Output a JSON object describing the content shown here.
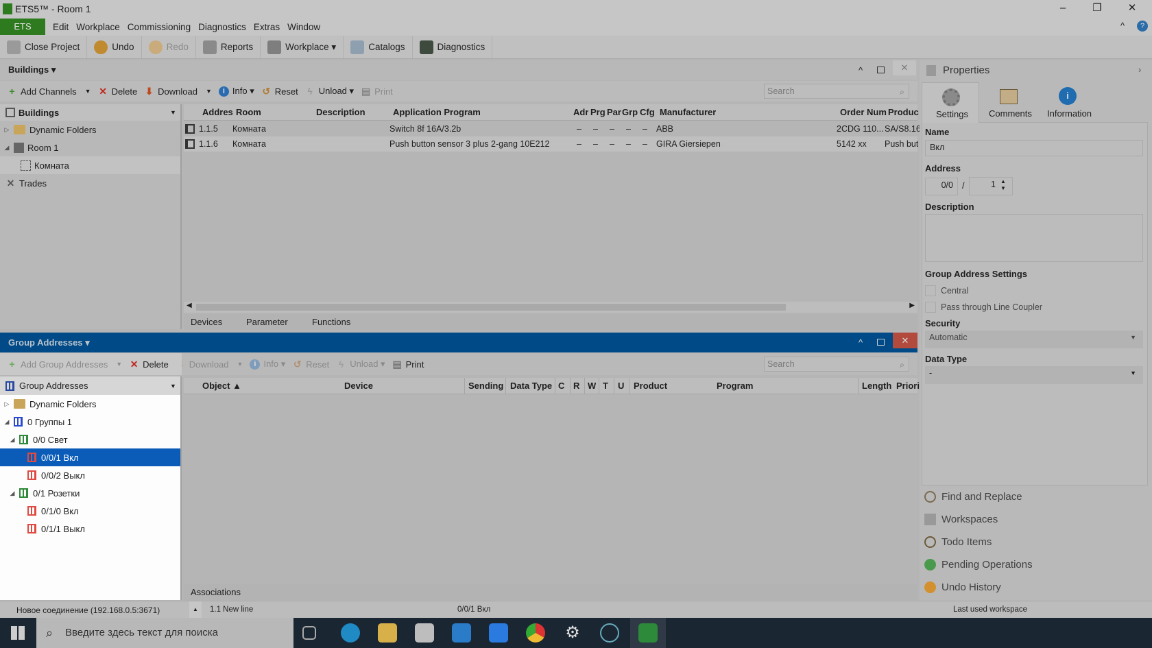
{
  "window": {
    "title": "ETS5™ - Room 1",
    "minimize": "–",
    "maximize": "❐",
    "close": "✕"
  },
  "menu": {
    "items": [
      "ETS",
      "Edit",
      "Workplace",
      "Commissioning",
      "Diagnostics",
      "Extras",
      "Window"
    ],
    "collapse": "^",
    "help": "?"
  },
  "toolbar": {
    "close_project": "Close Project",
    "undo": "Undo",
    "redo": "Redo",
    "reports": "Reports",
    "workplace": "Workplace ▾",
    "catalogs": "Catalogs",
    "diagnostics": "Diagnostics"
  },
  "buildings": {
    "title": "Buildings ▾",
    "toolbar": {
      "add_channels": "Add Channels",
      "delete": "Delete",
      "download": "Download",
      "info": "Info ▾",
      "reset": "Reset",
      "unload": "Unload ▾",
      "print": "Print"
    },
    "search_placeholder": "Search",
    "tree": {
      "header": "Buildings",
      "items": [
        "Dynamic Folders",
        "Room 1",
        "Комната",
        "Trades"
      ]
    },
    "columns": [
      "Addres",
      "Room",
      "Description",
      "Application Program",
      "Adr",
      "Prg",
      "Par",
      "Grp",
      "Cfg",
      "Manufacturer",
      "Order Num",
      "Produc"
    ],
    "rows": [
      [
        "1.1.5",
        "Комната",
        "",
        "Switch 8f 16A/3.2b",
        "–",
        "–",
        "–",
        "–",
        "–",
        "ABB",
        "2CDG 110...",
        "SA/S8.16"
      ],
      [
        "1.1.6",
        "Комната",
        "",
        "Push button sensor 3 plus 2-gang 10E212",
        "–",
        "–",
        "–",
        "–",
        "–",
        "GIRA Giersiepen",
        "5142 xx",
        "Push but"
      ]
    ],
    "tabs": [
      "Devices",
      "Parameter",
      "Functions"
    ]
  },
  "group_addresses": {
    "title": "Group Addresses ▾",
    "toolbar": {
      "add": "Add Group Addresses",
      "delete": "Delete",
      "download": "Download",
      "info": "Info ▾",
      "reset": "Reset",
      "unload": "Unload ▾",
      "print": "Print"
    },
    "search_placeholder": "Search",
    "tree": {
      "header": "Group Addresses",
      "items": [
        "Dynamic Folders",
        "0 Группы 1",
        "0/0 Свет",
        "0/0/1 Вкл",
        "0/0/2 Выкл",
        "0/1 Розетки",
        "0/1/0 Вкл",
        "0/1/1 Выкл"
      ],
      "selected": "0/0/1 Вкл"
    },
    "columns": [
      "Object ▲",
      "Device",
      "Sending",
      "Data Type",
      "C",
      "R",
      "W",
      "T",
      "U",
      "Product",
      "Program",
      "Length",
      "Priori"
    ],
    "tabs": [
      "Associations"
    ],
    "header_color": "#004a88"
  },
  "properties": {
    "title": "Properties",
    "tabs": [
      "Settings",
      "Comments",
      "Information"
    ],
    "name_label": "Name",
    "name_value": "Вкл",
    "address_label": "Address",
    "address_main": "0/0",
    "address_sep": "/",
    "address_sub": "1",
    "description_label": "Description",
    "ga_settings_label": "Group Address Settings",
    "central": "Central",
    "central_checked": false,
    "pass_through": "Pass through Line Coupler",
    "pass_through_checked": false,
    "security_label": "Security",
    "security_value": "Automatic",
    "datatype_label": "Data Type",
    "datatype_value": "-"
  },
  "dock": [
    "Find and Replace",
    "Workspaces",
    "Todo Items",
    "Pending Operations",
    "Undo History"
  ],
  "status": {
    "connection": "Новое соединение (192.168.0.5:3671)",
    "line": "1.1 New line",
    "selected": "0/0/1 Вкл",
    "workspace": "Last used workspace"
  },
  "taskbar": {
    "search_placeholder": "Введите здесь текст для поиска"
  }
}
